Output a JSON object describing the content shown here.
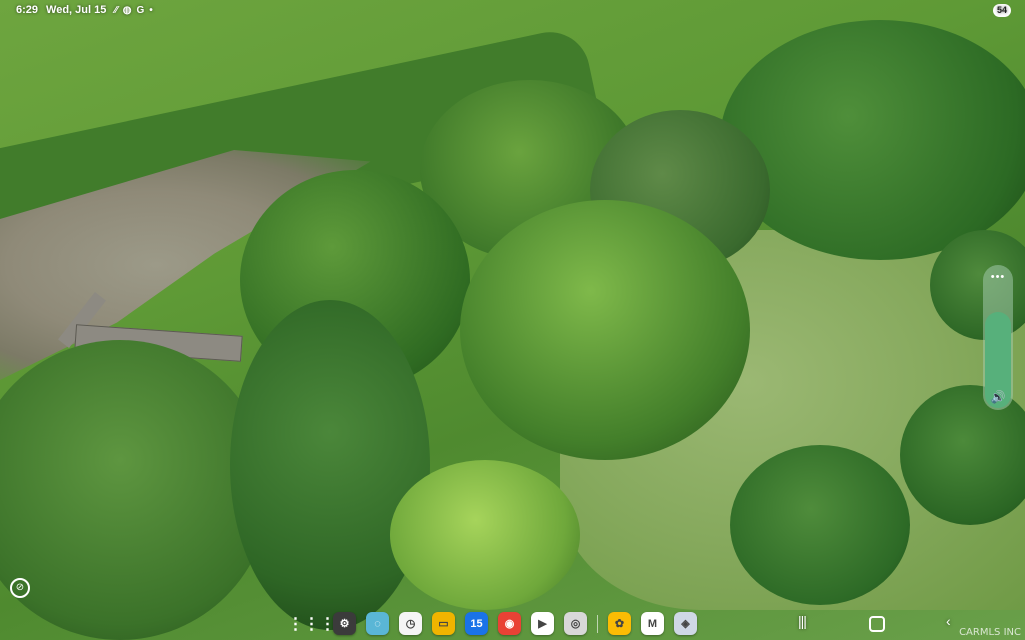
{
  "status_bar": {
    "time": "6:29",
    "date": "Wed, Jul 15",
    "icons": [
      "signal-icon",
      "messenger-icon",
      "google-icon",
      "dot-icon"
    ],
    "battery": "54"
  },
  "volume_panel": {
    "more_label": "•••",
    "level_fraction": 0.68,
    "speaker_glyph": "🔊"
  },
  "taskbar": {
    "apps": [
      {
        "name": "app-drawer-icon",
        "glyph": "⋮⋮⋮",
        "color": "transparent"
      },
      {
        "name": "settings-icon",
        "glyph": "⚙",
        "color": "#3b3b3b"
      },
      {
        "name": "messages-icon",
        "glyph": "◌",
        "color": "#5ab6d6"
      },
      {
        "name": "clock-icon",
        "glyph": "◷",
        "color": "#f5f5f5"
      },
      {
        "name": "files-icon",
        "glyph": "▭",
        "color": "#f0b400"
      },
      {
        "name": "calendar-icon",
        "glyph": "15",
        "color": "#1a73e8"
      },
      {
        "name": "chrome-icon",
        "glyph": "◉",
        "color": "#e94235"
      },
      {
        "name": "play-store-icon",
        "glyph": "▶",
        "color": "#ffffff"
      },
      {
        "name": "camera-icon",
        "glyph": "◎",
        "color": "#d8d8d8"
      },
      {
        "name": "photos-icon",
        "glyph": "✿",
        "color": "#fbbc04"
      },
      {
        "name": "gmail-icon",
        "glyph": "M",
        "color": "#ffffff"
      },
      {
        "name": "gallery-icon",
        "glyph": "◈",
        "color": "#cfd8e6"
      }
    ],
    "nav": {
      "recent": "|||",
      "back": "‹"
    },
    "watermark": "CARMLS INC"
  }
}
